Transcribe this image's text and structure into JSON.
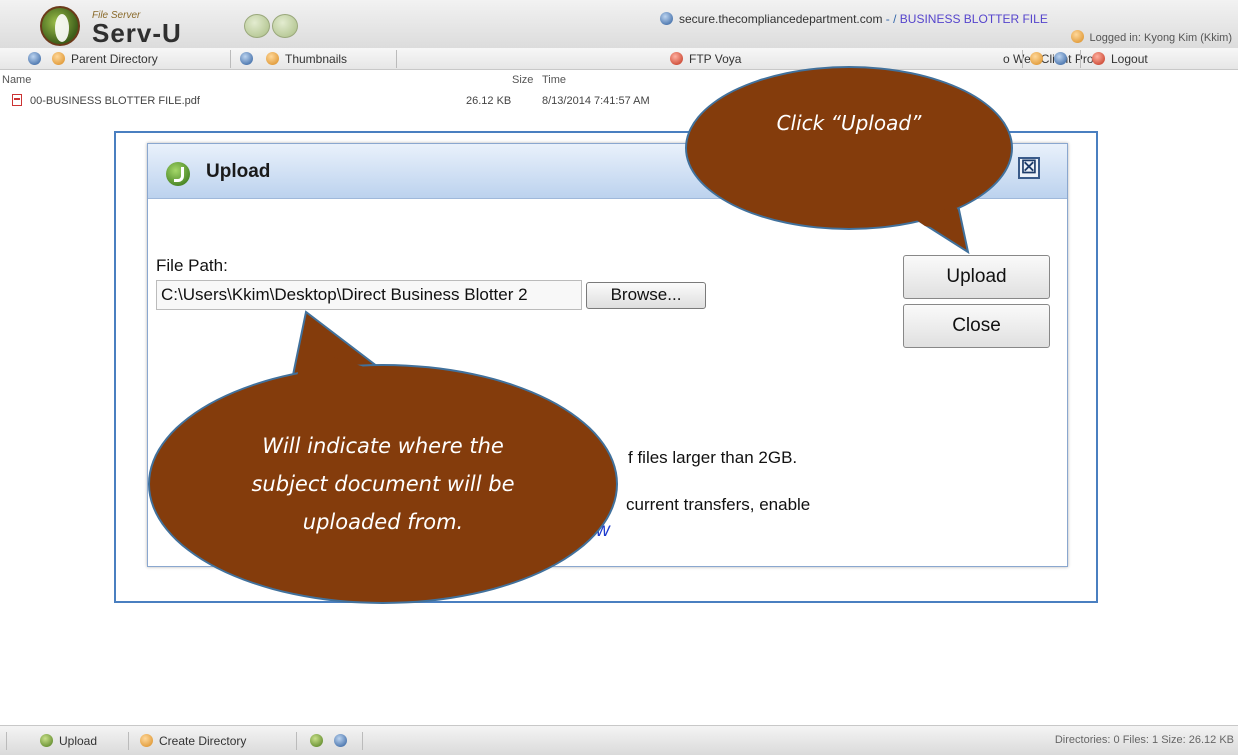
{
  "header": {
    "logo_small": "File Server",
    "logo_big": "Serv-U",
    "site": "secure.thecompliancedepartment.com",
    "path_sep": " - /",
    "folder": "BUSINESS BLOTTER FILE",
    "logged_in": "Logged in: Kyong Kim (Kkim)"
  },
  "toolbar": {
    "parent_directory": "Parent Directory",
    "thumbnails": "Thumbnails",
    "ftp_voyager": "FTP Voya",
    "web_client_pro": "o Web Client Pro",
    "logout": "Logout"
  },
  "file_list": {
    "columns": {
      "name": "Name",
      "size": "Size",
      "time": "Time"
    },
    "rows": [
      {
        "name": "00-BUSINESS BLOTTER FILE.pdf",
        "size": "26.12 KB",
        "time": "8/13/2014 7:41:57 AM"
      }
    ]
  },
  "dialog": {
    "title": "Upload",
    "close_glyph": "☒",
    "file_path_label": "File Path:",
    "file_path_value": "C:\\Users\\Kkim\\Desktop\\Direct Business Blotter 2",
    "browse_label": "Browse...",
    "upload_label": "Upload",
    "close_label": "Close",
    "msg_large_files": "f files larger than 2GB.",
    "msg_concurrent": "current transfers, enable",
    "msg_link_fragment": "w"
  },
  "callouts": {
    "upload": "Click “Upload”",
    "path": "Will indicate where the subject document will be uploaded from.",
    "fill": "#843C0C",
    "border": "#41719C"
  },
  "bottom": {
    "upload": "Upload",
    "create_directory": "Create Directory",
    "status": "Directories: 0   Files: 1   Size: 26.12 KB"
  }
}
